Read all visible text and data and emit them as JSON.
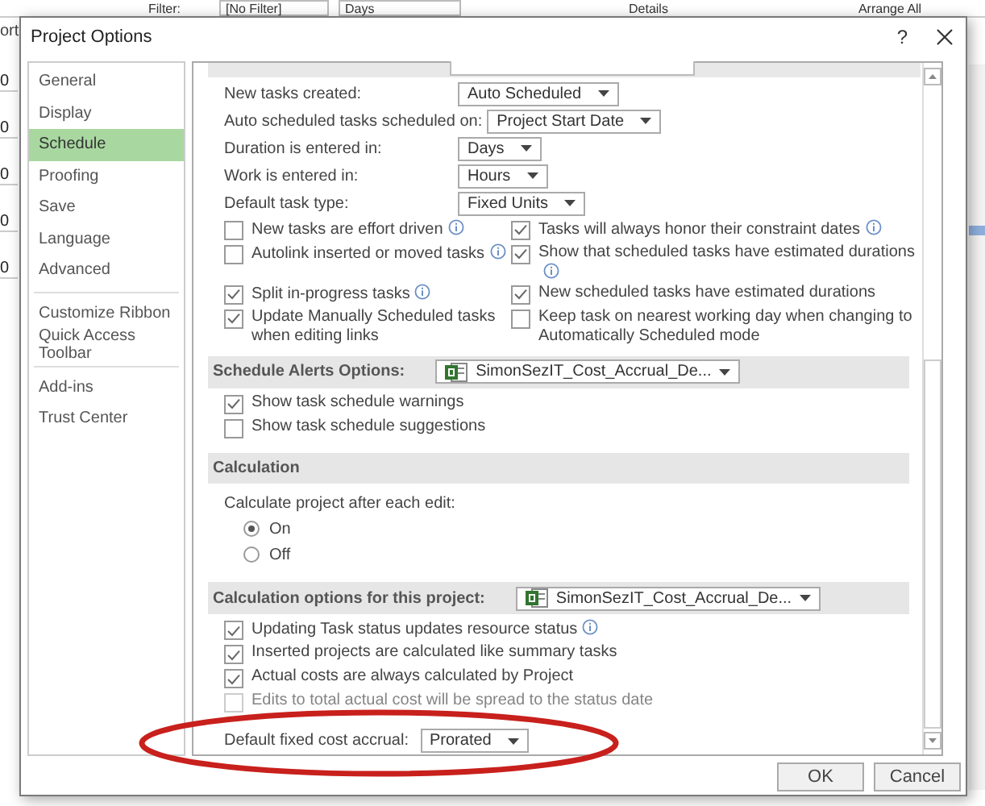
{
  "background_app": {
    "ribbon": {
      "left_label": "ort",
      "filter_label": "Filter:",
      "filter_value": "[No Filter]",
      "duration_value": "Days",
      "details_label": "Details",
      "arrange_label": "Arrange All"
    },
    "cells": [
      "0",
      "0",
      "0",
      "0",
      "0"
    ]
  },
  "dialog": {
    "title": "Project Options",
    "help": "?",
    "sidebar": [
      [
        {
          "label": "General",
          "selected": false
        },
        {
          "label": "Display",
          "selected": false
        },
        {
          "label": "Schedule",
          "selected": true
        },
        {
          "label": "Proofing",
          "selected": false
        },
        {
          "label": "Save",
          "selected": false
        },
        {
          "label": "Language",
          "selected": false
        },
        {
          "label": "Advanced",
          "selected": false
        }
      ],
      [
        {
          "label": "Customize Ribbon",
          "selected": false
        },
        {
          "label": "Quick Access Toolbar",
          "selected": false
        }
      ],
      [
        {
          "label": "Add-ins",
          "selected": false
        },
        {
          "label": "Trust Center",
          "selected": false
        }
      ]
    ],
    "schedule_fields": [
      {
        "label": "New tasks created:",
        "value": "Auto Scheduled"
      },
      {
        "label": "Auto scheduled tasks scheduled on:",
        "value": "Project Start Date"
      },
      {
        "label": "Duration is entered in:",
        "value": "Days"
      },
      {
        "label": "Work is entered in:",
        "value": "Hours"
      },
      {
        "label": "Default task type:",
        "value": "Fixed Units"
      }
    ],
    "schedule_options": [
      {
        "label": "New tasks are effort driven",
        "checked": false,
        "info": true
      },
      {
        "label": "Tasks will always honor their constraint dates",
        "checked": true,
        "info": true
      },
      {
        "label": "Autolink inserted or moved tasks",
        "checked": false,
        "info": true
      },
      {
        "label": "Show that scheduled tasks have estimated durations",
        "checked": true,
        "info": true
      },
      {
        "label": "Split in-progress tasks",
        "checked": true,
        "info": true
      },
      {
        "label": "New scheduled tasks have estimated durations",
        "checked": true,
        "info": false
      },
      {
        "label": "Update Manually Scheduled tasks when editing links",
        "checked": true,
        "info": false
      },
      {
        "label": "Keep task on nearest working day when changing to Automatically Scheduled mode",
        "checked": false,
        "info": false
      }
    ],
    "alerts": {
      "title": "Schedule Alerts Options:",
      "file": "SimonSezIT_Cost_Accrual_De...",
      "options": [
        {
          "label": "Show task schedule warnings",
          "checked": true,
          "info": false,
          "disabled": false
        },
        {
          "label": "Show task schedule suggestions",
          "checked": false,
          "info": false,
          "disabled": false
        }
      ]
    },
    "calculation": {
      "title": "Calculation",
      "prompt": "Calculate project after each edit:",
      "radios": [
        {
          "label": "On",
          "selected": true
        },
        {
          "label": "Off",
          "selected": false
        }
      ]
    },
    "calc_options": {
      "title": "Calculation options for this project:",
      "file": "SimonSezIT_Cost_Accrual_De...",
      "options": [
        {
          "label": "Updating Task status updates resource status",
          "checked": true,
          "info": true,
          "disabled": false
        },
        {
          "label": "Inserted projects are calculated like summary tasks",
          "checked": true,
          "info": false,
          "disabled": false
        },
        {
          "label": "Actual costs are always calculated by Project",
          "checked": true,
          "info": false,
          "disabled": false
        },
        {
          "label": "Edits to total actual cost will be spread to the status date",
          "checked": false,
          "info": false,
          "disabled": true
        }
      ],
      "accrual": {
        "label": "Default fixed cost accrual:",
        "value": "Prorated"
      }
    },
    "buttons": [
      "OK",
      "Cancel"
    ]
  }
}
